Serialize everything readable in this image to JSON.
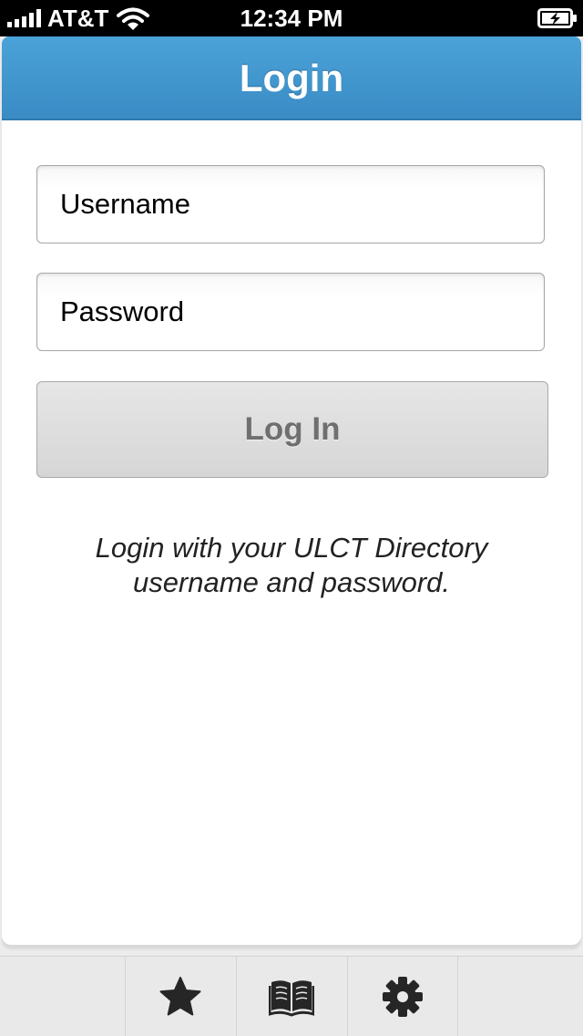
{
  "status_bar": {
    "carrier": "AT&T",
    "time": "12:34 PM",
    "icons": [
      "signal-icon",
      "wifi-icon",
      "battery-charging-icon"
    ]
  },
  "nav": {
    "title": "Login",
    "color": "#3f96cf"
  },
  "form": {
    "username_placeholder": "Username",
    "username_value": "",
    "password_placeholder": "Password",
    "password_value": "",
    "login_label": "Log In",
    "hint": "Login with your ULCT Directory username and password."
  },
  "tab_bar": {
    "tabs": [
      {
        "icon": "star-icon"
      },
      {
        "icon": "book-icon"
      },
      {
        "icon": "gear-icon"
      }
    ]
  }
}
